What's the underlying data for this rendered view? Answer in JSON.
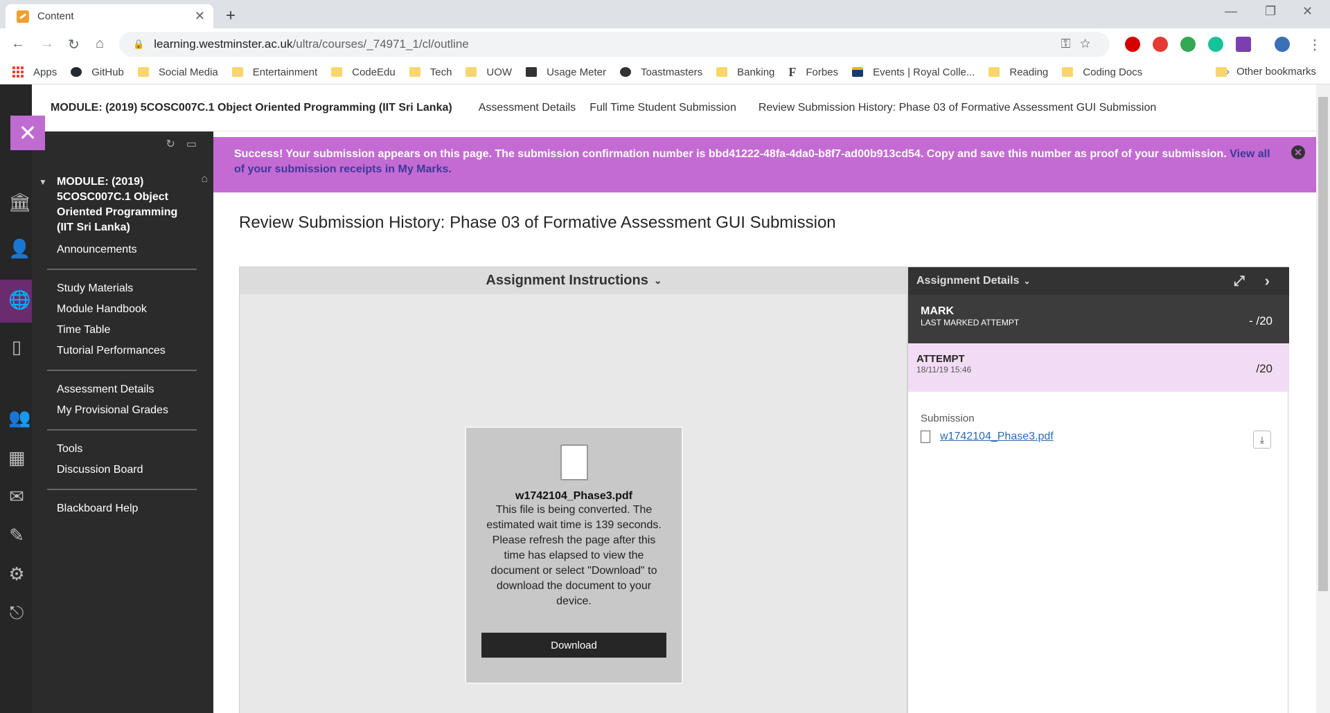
{
  "browser": {
    "tab_title": "Content",
    "url_domain": "learning.westminster.ac.uk",
    "url_path": "/ultra/courses/_74971_1/cl/outline"
  },
  "bookmarks": {
    "items": [
      "Apps",
      "GitHub",
      "Social Media",
      "Entertainment",
      "CodeEdu",
      "Tech",
      "UOW",
      "Usage Meter",
      "Toastmasters",
      "Banking",
      "Forbes",
      "Events | Royal Colle...",
      "Reading",
      "Coding Docs"
    ],
    "more": "»",
    "other": "Other bookmarks"
  },
  "coursebar": {
    "title": "MODULE: (2019) 5COSC007C.1 Object Oriented Programming (IIT Sri Lanka)",
    "links": [
      "Assessment Details",
      "Full Time Student Submission",
      "Review Submission History: Phase 03 of Formative Assessment GUI Submission"
    ]
  },
  "sidemenu": {
    "module_title": "MODULE: (2019) 5COSC007C.1 Object Oriented Programming (IIT Sri Lanka)",
    "items": [
      "Announcements",
      "Study Materials",
      "Module Handbook",
      "Time Table",
      "Tutorial Performances",
      "Assessment Details",
      "My Provisional Grades",
      "Tools",
      "Discussion Board",
      "Blackboard Help"
    ]
  },
  "banner": {
    "message": "Success! Your submission appears on this page. The submission confirmation number is bbd41222-48fa-4da0-b8f7-ad00b913cd54. Copy and save this number as proof of your submission.",
    "link": "View all of your submission receipts in My Marks."
  },
  "page": {
    "title": "Review Submission History: Phase 03 of Formative Assessment GUI Submission"
  },
  "instructions": {
    "header": "Assignment Instructions"
  },
  "doc": {
    "filename": "w1742104_Phase3.pdf",
    "message": "This file is being converted. The estimated wait time is 139 seconds. Please refresh the page after this time has elapsed to view the document or select \"Download\" to download the document to your device.",
    "download": "Download"
  },
  "details": {
    "header": "Assignment Details",
    "mark_label": "MARK",
    "mark_sub": "LAST MARKED ATTEMPT",
    "mark_value": "- /20",
    "attempt_label": "ATTEMPT",
    "attempt_date": "18/11/19 15:46",
    "attempt_value": "/20",
    "submission_label": "Submission",
    "submission_file": "w1742104_Phase3.pdf"
  },
  "colors": {
    "accent": "#c36bd3",
    "attempt_bg": "#f2dcf5",
    "sidebar": "#2b2b2b"
  }
}
